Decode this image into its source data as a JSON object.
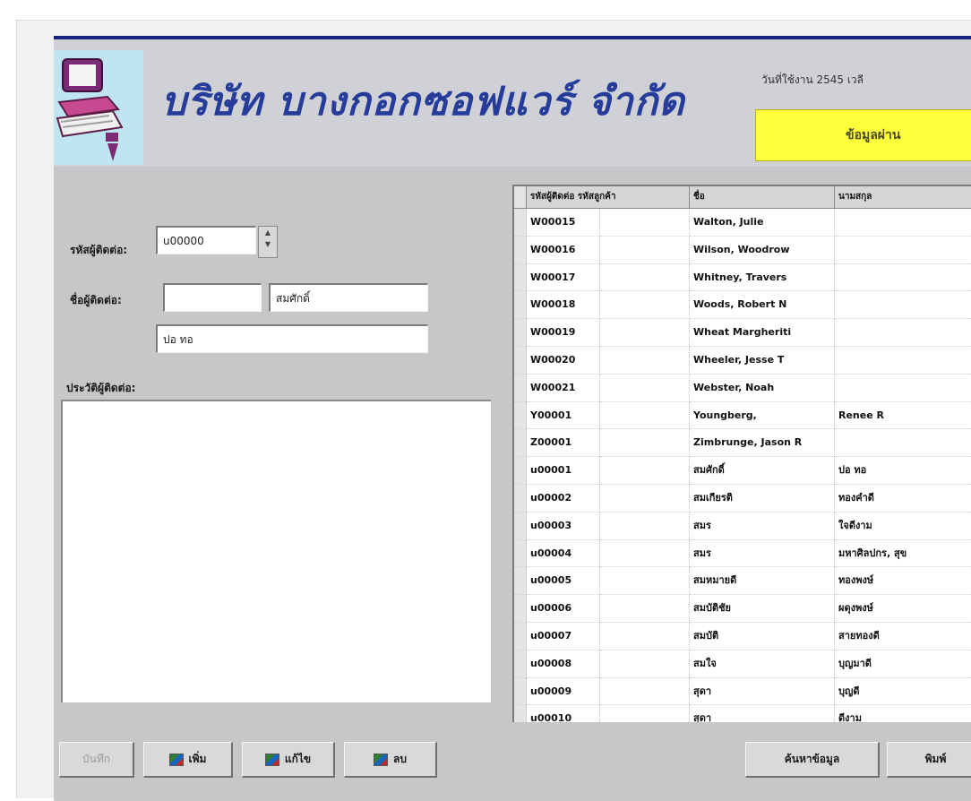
{
  "banner": {
    "company_name": "บริษัท บางกอกซอฟแวร์ จำกัด",
    "info_text": "วันที่ใช้งาน 2545    เวลี",
    "status": "ข้อมูลผ่าน"
  },
  "form": {
    "code_label": "รหัสผู้ติดต่อ:",
    "code_value": "u00000",
    "name_label": "ชื่อผู้ติดต่อ:",
    "first_name": "",
    "last_name": "สมศักดิ์",
    "nickname": "ปอ ทอ",
    "notes_label": "ประวัติผู้ติดต่อ:"
  },
  "grid": {
    "columns": [
      "รหัสผู้ติดต่อ รหัสลูกค้า",
      "ชื่อ",
      "นามสกุล"
    ],
    "rows": [
      {
        "code": "W00015",
        "name": "Walton, Julie",
        "extra": ""
      },
      {
        "code": "W00016",
        "name": "Wilson, Woodrow",
        "extra": ""
      },
      {
        "code": "W00017",
        "name": "Whitney, Travers",
        "extra": ""
      },
      {
        "code": "W00018",
        "name": "Woods, Robert N",
        "extra": ""
      },
      {
        "code": "W00019",
        "name": "Wheat Margheriti",
        "extra": ""
      },
      {
        "code": "W00020",
        "name": "Wheeler, Jesse T",
        "extra": ""
      },
      {
        "code": "W00021",
        "name": "Webster, Noah",
        "extra": ""
      },
      {
        "code": "Y00001",
        "name": "Youngberg,",
        "extra": "Renee R"
      },
      {
        "code": "Z00001",
        "name": "Zimbrunge, Jason R",
        "extra": ""
      },
      {
        "code": "u00001",
        "name": "สมศักดิ์",
        "extra": "ปอ ทอ"
      },
      {
        "code": "u00002",
        "name": "สมเกียรติ",
        "extra": "ทองคำดี"
      },
      {
        "code": "u00003",
        "name": "สมร",
        "extra": "ใจดีงาม"
      },
      {
        "code": "u00004",
        "name": "สมร",
        "extra": "มหาศิลปกร, สุข"
      },
      {
        "code": "u00005",
        "name": "สมหมายดี",
        "extra": "ทองพงษ์"
      },
      {
        "code": "u00006",
        "name": "สมบัติชัย",
        "extra": "ผดุงพงษ์"
      },
      {
        "code": "u00007",
        "name": "สมบัติ",
        "extra": "สายทองดี"
      },
      {
        "code": "u00008",
        "name": "สมใจ",
        "extra": "บุญมาดี"
      },
      {
        "code": "u00009",
        "name": "สุดา",
        "extra": "บุญดี"
      },
      {
        "code": "u00010",
        "name": "สุดา",
        "extra": "ดีงาม"
      }
    ]
  },
  "toolbar": {
    "disabled_label": "บันทึก",
    "add_label": "เพิ่ม",
    "edit_label": "แก้ไข",
    "delete_label": "ลบ",
    "right1_label": "ค้นหาข้อมูล",
    "right2_label": "พิมพ์"
  }
}
